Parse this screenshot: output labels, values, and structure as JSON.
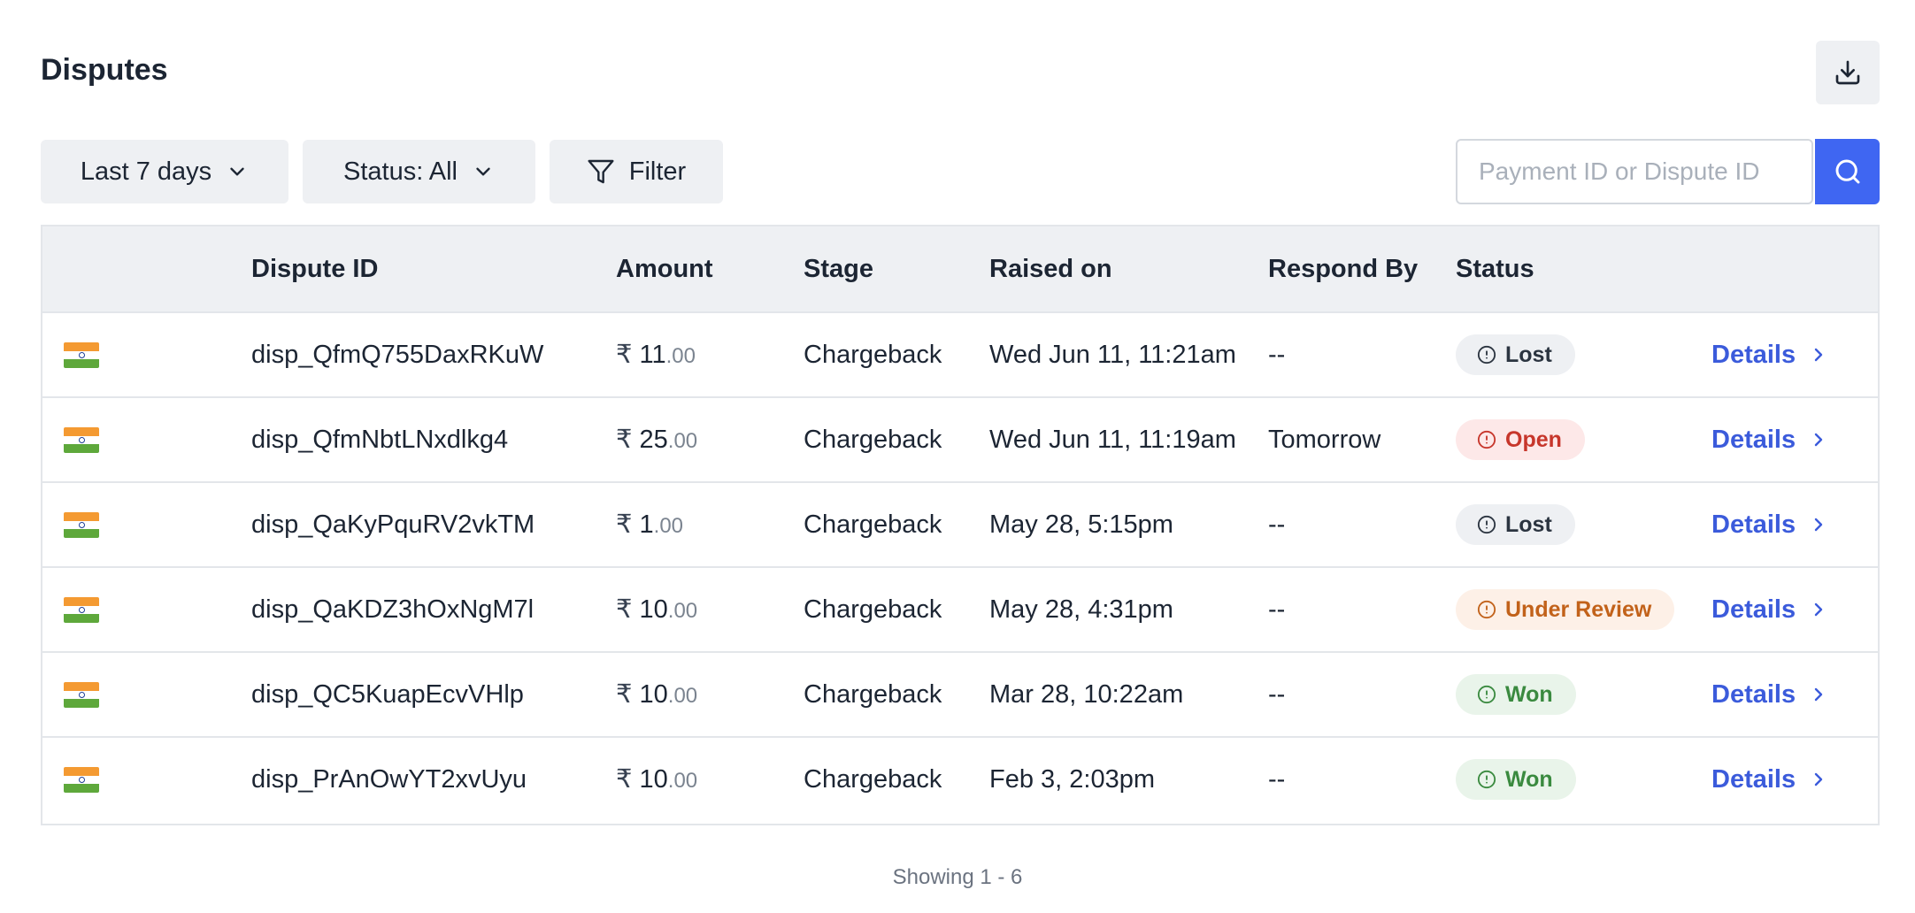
{
  "page": {
    "title": "Disputes"
  },
  "toolbar": {
    "date_range": "Last 7 days",
    "status_filter": "Status: All",
    "filter_label": "Filter",
    "search_placeholder": "Payment ID or Dispute ID",
    "search_value": ""
  },
  "table": {
    "headers": [
      "",
      "Dispute ID",
      "Amount",
      "Stage",
      "Raised on",
      "Respond By",
      "Status",
      ""
    ],
    "currency_symbol": "₹",
    "rows": [
      {
        "id": "disp_QfmQ755DaxRKuW",
        "amount_int": "11",
        "amount_dec": ".00",
        "stage": "Chargeback",
        "raised_on": "Wed Jun 11, 11:21am",
        "respond_by": "--",
        "status": "Lost",
        "action": "Details"
      },
      {
        "id": "disp_QfmNbtLNxdlkg4",
        "amount_int": "25",
        "amount_dec": ".00",
        "stage": "Chargeback",
        "raised_on": "Wed Jun 11, 11:19am",
        "respond_by": "Tomorrow",
        "status": "Open",
        "action": "Details"
      },
      {
        "id": "disp_QaKyPquRV2vkTM",
        "amount_int": "1",
        "amount_dec": ".00",
        "stage": "Chargeback",
        "raised_on": "May 28, 5:15pm",
        "respond_by": "--",
        "status": "Lost",
        "action": "Details"
      },
      {
        "id": "disp_QaKDZ3hOxNgM7l",
        "amount_int": "10",
        "amount_dec": ".00",
        "stage": "Chargeback",
        "raised_on": "May 28, 4:31pm",
        "respond_by": "--",
        "status": "Under Review",
        "action": "Details"
      },
      {
        "id": "disp_QC5KuapEcvVHlp",
        "amount_int": "10",
        "amount_dec": ".00",
        "stage": "Chargeback",
        "raised_on": "Mar 28, 10:22am",
        "respond_by": "--",
        "status": "Won",
        "action": "Details"
      },
      {
        "id": "disp_PrAnOwYT2xvUyu",
        "amount_int": "10",
        "amount_dec": ".00",
        "stage": "Chargeback",
        "raised_on": "Feb 3, 2:03pm",
        "respond_by": "--",
        "status": "Won",
        "action": "Details"
      }
    ]
  },
  "footer": {
    "showing": "Showing 1 - 6"
  },
  "colors": {
    "accent": "#3f66f2",
    "link": "#3b5bdb",
    "status_lost": "#2b3440",
    "status_open": "#c7362b",
    "status_under_review": "#c2621a",
    "status_won": "#3a8a3f"
  },
  "icons": {
    "download": "download-icon",
    "chevron": "chevron-down-icon",
    "filter": "filter-icon",
    "search": "search-icon",
    "flag": "india-flag-icon",
    "status": "info-circle-icon",
    "details": "chevron-right-icon"
  }
}
